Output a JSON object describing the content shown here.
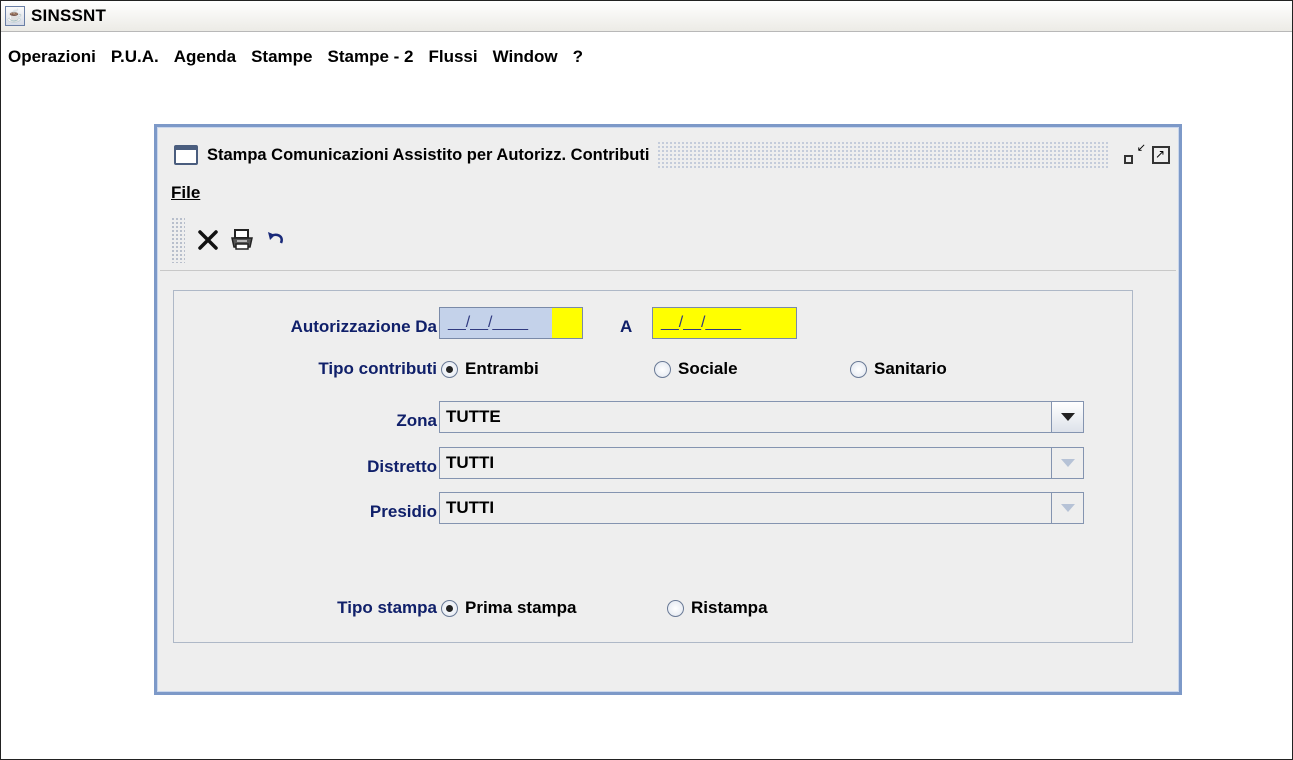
{
  "app": {
    "title": "SINSSNT"
  },
  "menubar": [
    "Operazioni",
    "P.U.A.",
    "Agenda",
    "Stampe",
    "Stampe - 2",
    "Flussi",
    "Window",
    "?"
  ],
  "window": {
    "title": "Stampa Comunicazioni Assistito per Autorizz. Contributi",
    "menu_file": "File",
    "toolbar": {
      "close_icon": "close-icon",
      "print_icon": "printer-icon",
      "undo_icon": "undo-icon"
    }
  },
  "form": {
    "autorizzazione_label": "Autorizzazione Da",
    "da_value": "__/__/____",
    "a_label": "A",
    "a_value": "__/__/____",
    "tipo_contributi_label": "Tipo contributi",
    "tipo_contributi_options": [
      "Entrambi",
      "Sociale",
      "Sanitario"
    ],
    "tipo_contributi_selected": "Entrambi",
    "zona_label": "Zona",
    "zona_value": "TUTTE",
    "distretto_label": "Distretto",
    "distretto_value": "TUTTI",
    "presidio_label": "Presidio",
    "presidio_value": "TUTTI",
    "tipo_stampa_label": "Tipo stampa",
    "tipo_stampa_options": [
      "Prima stampa",
      "Ristampa"
    ],
    "tipo_stampa_selected": "Prima stampa"
  },
  "colors": {
    "required_field": "#ffff00",
    "label_text": "#10206a",
    "frame_border": "#7d99c8"
  }
}
